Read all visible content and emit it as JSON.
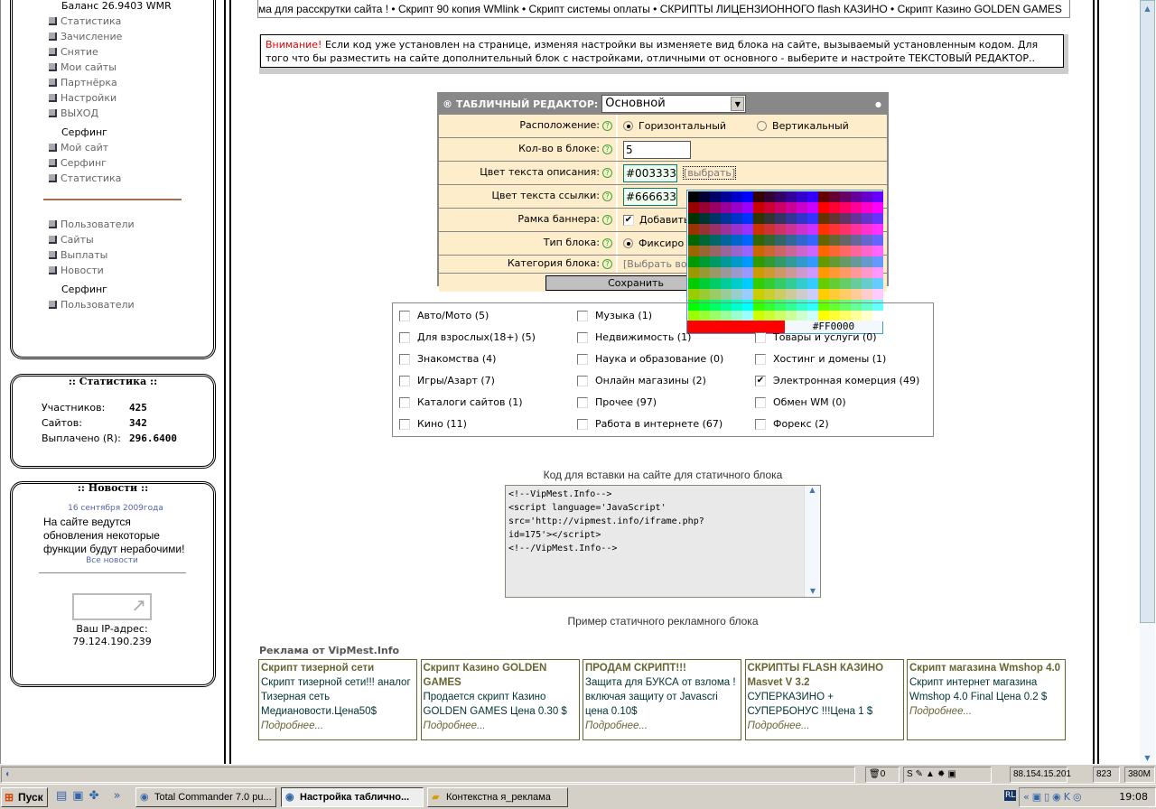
{
  "sidebar": {
    "balance": "Баланс 26.9403 WMR",
    "account_items": [
      "Статистика",
      "Зачисление",
      "Снятие",
      "Мои сайты",
      "Партнёрка",
      "Настройки",
      "ВЫХОД"
    ],
    "surfing_header": "Серфинг",
    "surfing_items": [
      "Мой сайт",
      "Серфинг",
      "Статистика"
    ],
    "admin_items": [
      "Пользователи",
      "Сайты",
      "Выплаты",
      "Новости"
    ],
    "admin_surfing_header": "Серфинг",
    "admin_surfing_items": [
      "Пользователи"
    ],
    "stats": {
      "title": ":: Статистика ::",
      "members_label": "Участников:",
      "members": "425",
      "sites_label": "Сайтов:",
      "sites": "342",
      "paid_label": "Выплачено (R):",
      "paid": "296.6400"
    },
    "news": {
      "title": ":: Новости ::",
      "date": "16 сентября 2009года",
      "text": "На сайте ведутся обновления некоторые функции будут нерабочими!",
      "all_link": "Все новости"
    },
    "ip": {
      "label": "Ваш IP-адрес:",
      "value": "79.124.190.239"
    }
  },
  "ticker": "ма для расскрутки сайта ! • Скрипт 90 копия WMlink • Скрипт системы оплаты • СКРИПТЫ ЛИЦЕНЗИОННОГО flash КАЗИНО • Скрипт Казино GOLDEN GAMES",
  "warning": {
    "prefix": "Внимание!",
    "text": " Если код уже установлен на странице, изменяя настройки вы изменяете вид блока на сайте, вызываемый установленным кодом. Для того что бы разместить на сайте дополнительный блок с настройками, отличными от основного - выберите и настройте ТЕКСТОВЫЙ РЕДАКТОР.."
  },
  "editor": {
    "title": "® ТАБЛИЧНЫЙ РЕДАКТОР:",
    "preset": "Основной",
    "layout_label": "Расположение:",
    "layout_h": "Горизонтальный",
    "layout_v": "Вертикальный",
    "count_label": "Кол-во в блоке:",
    "count": "5",
    "desc_color_label": "Цвет текста описания:",
    "desc_color": "#003333",
    "pick": "[выбрать]",
    "link_color_label": "Цвет текста ссылки:",
    "link_color": "#666633",
    "frame_label": "Рамка баннера:",
    "frame_text": "Добавить",
    "type_label": "Тип блока:",
    "type_text": "Фиксиро",
    "category_label": "Категория блока:",
    "category_text": "[Выбрать во",
    "save": "Сохранить"
  },
  "palette": {
    "selected": "#FF0000",
    "selected_color": "#ff0000"
  },
  "categories": [
    {
      "label": "Авто/Мото (5)",
      "checked": false
    },
    {
      "label": "Для взрослых(18+) (5)",
      "checked": false
    },
    {
      "label": "Знакомства (4)",
      "checked": false
    },
    {
      "label": "Игры/Азарт (7)",
      "checked": false
    },
    {
      "label": "Каталоги сайтов (1)",
      "checked": false
    },
    {
      "label": "Кино (11)",
      "checked": false
    },
    {
      "label": "Музыка (1)",
      "checked": false
    },
    {
      "label": "Недвижимость (1)",
      "checked": false
    },
    {
      "label": "Наука и образование (0)",
      "checked": false
    },
    {
      "label": "Онлайн магазины (2)",
      "checked": false
    },
    {
      "label": "Прочее (97)",
      "checked": false
    },
    {
      "label": "Работа в интернете (67)",
      "checked": false
    },
    {
      "label": "",
      "checked": false
    },
    {
      "label": "Товары и услуги (0)",
      "checked": false
    },
    {
      "label": "Хостинг и домены (1)",
      "checked": false
    },
    {
      "label": "Электронная комерция (49)",
      "checked": true
    },
    {
      "label": "Обмен WM (0)",
      "checked": false
    },
    {
      "label": "Форекс (2)",
      "checked": false
    }
  ],
  "code": {
    "title": "Код для вставки на сайте для статичного блока",
    "value": "<!--VipMest.Info-->\n<script language='JavaScript'\nsrc='http://vipmest.info/iframe.php?\nid=175'></script>\n<!--/VipMest.Info-->",
    "example_title": "Пример статичного рекламного блока"
  },
  "ads": {
    "title": "Реклама от VipMest.Info",
    "items": [
      {
        "title": "Скрипт тизерной сети",
        "text": "Скрипт тизерной сети!!! аналог Тизерная сеть Медиановости.Цена50$",
        "more": "Подробнее..."
      },
      {
        "title": "Скрипт Казино GOLDEN GAMES",
        "text": "Продается скрипт Казино GOLDEN GAMES Цена 0.30 $",
        "more": "Подробнее..."
      },
      {
        "title": "ПРОДАМ СКРИПТ!!!",
        "text": "Защита для БУКСА от взлома !включая защиту от Javascri цена 0.10$",
        "more": "Подробнее..."
      },
      {
        "title": "СКРИПТЫ FLASH КАЗИНО Masvet V 3.2",
        "text": "СУПЕРКАЗИНО + СУПЕРБОНУС !!!Цена 1 $",
        "more": "Подробнее..."
      },
      {
        "title": "Скрипт магазина Wmshop 4.0",
        "text": "Скрипт интернет магазина Wmshop 4.0 Final Цена 0.2 $",
        "more": "Подробнее..."
      }
    ]
  },
  "statusbar": {
    "trash": "0",
    "ip": "88.154.15.201",
    "num": "823",
    "mem": "380M"
  },
  "taskbar": {
    "start": "Пуск",
    "windows": [
      "Total Commander 7.0 pu...",
      "Настройка таблично...",
      "Контекстна я_реклама"
    ],
    "lang": "RL",
    "clock": "19:08"
  }
}
